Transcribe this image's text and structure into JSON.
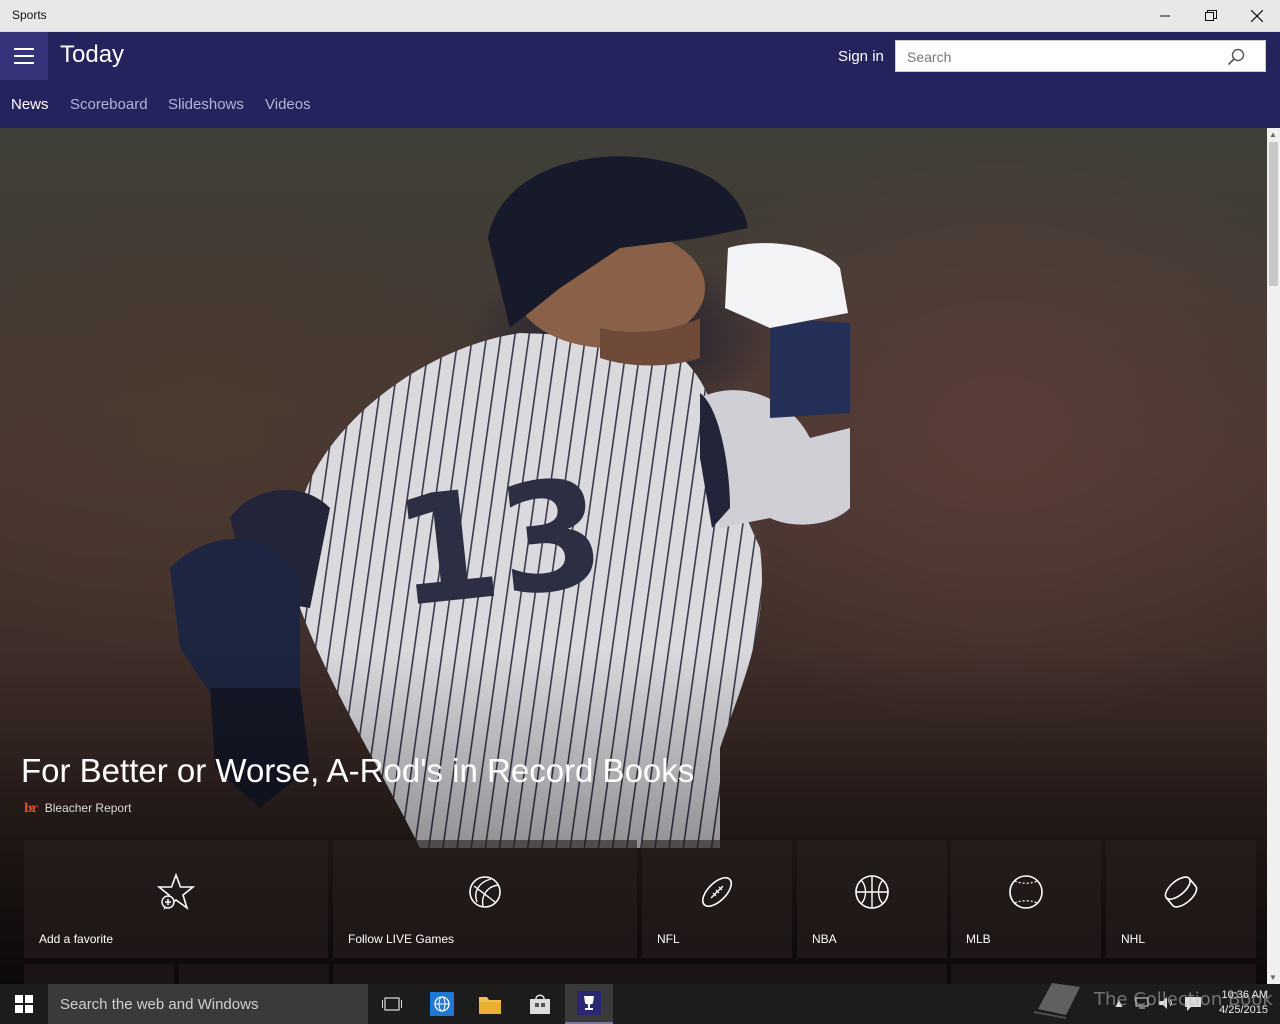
{
  "window": {
    "title": "Sports",
    "minimize_icon": "minimize-icon",
    "maximize_icon": "restore-icon",
    "close_icon": "close-icon"
  },
  "header": {
    "title": "Today",
    "sign_in": "Sign in",
    "search_placeholder": "Search",
    "accent_color": "#25235e"
  },
  "tabs": [
    {
      "label": "News",
      "active": true
    },
    {
      "label": "Scoreboard",
      "active": false
    },
    {
      "label": "Slideshows",
      "active": false
    },
    {
      "label": "Videos",
      "active": false
    }
  ],
  "hero": {
    "headline": "For Better or Worse, A-Rod's in Record Books",
    "source_logo": "br",
    "source": "Bleacher Report",
    "jersey_number": "13"
  },
  "tiles": [
    {
      "label": "Add a favorite",
      "icon": "star-add-icon"
    },
    {
      "label": "Follow LIVE Games",
      "icon": "sports-balls-icon"
    },
    {
      "label": "NFL",
      "icon": "football-icon"
    },
    {
      "label": "NBA",
      "icon": "basketball-icon"
    },
    {
      "label": "MLB",
      "icon": "baseball-icon"
    },
    {
      "label": "NHL",
      "icon": "hockey-puck-icon"
    }
  ],
  "taskbar": {
    "search_text": "Search the web and Windows",
    "time": "10:36 AM",
    "date": "4/25/2015",
    "watermark": "The Collection Book"
  }
}
